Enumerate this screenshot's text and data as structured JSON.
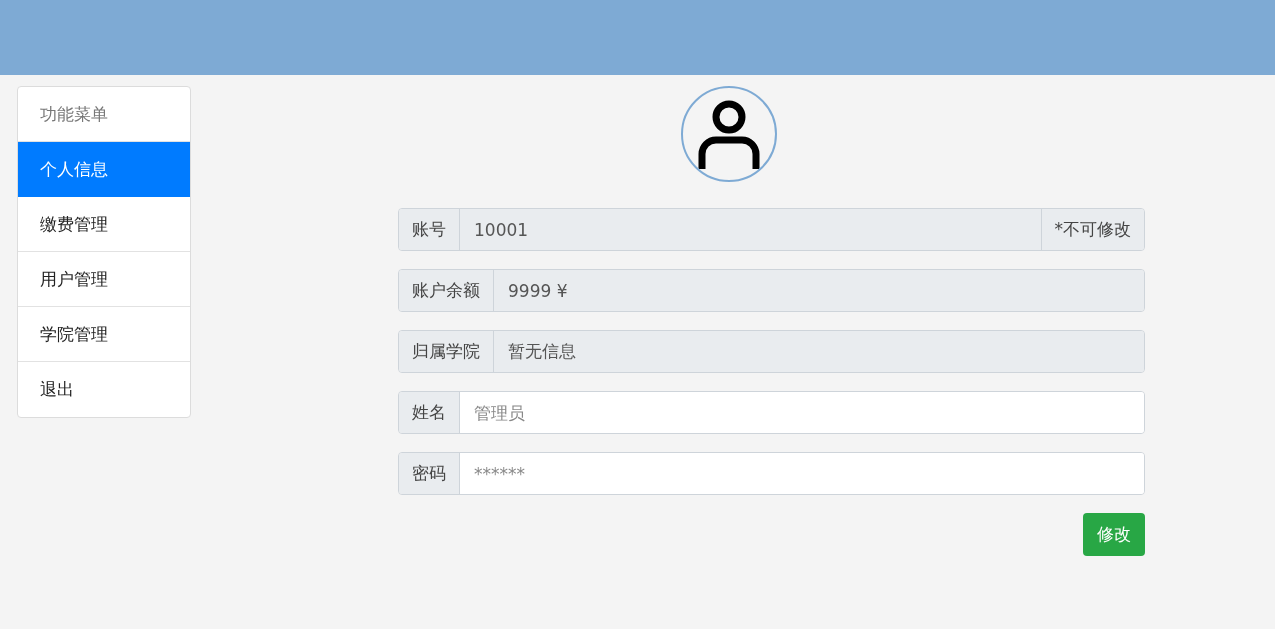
{
  "sidebar": {
    "heading": "功能菜单",
    "items": [
      {
        "label": "个人信息",
        "selected": true
      },
      {
        "label": "缴费管理",
        "selected": false
      },
      {
        "label": "用户管理",
        "selected": false
      },
      {
        "label": "学院管理",
        "selected": false
      },
      {
        "label": "退出",
        "selected": false
      }
    ]
  },
  "form": {
    "fields": [
      {
        "label": "账号",
        "value": "10001",
        "disabled": true,
        "note": "*不可修改"
      },
      {
        "label": "账户余额",
        "value": "9999 ¥",
        "disabled": true
      },
      {
        "label": "归属学院",
        "value": "暂无信息",
        "disabled": true
      },
      {
        "label": "姓名",
        "placeholder": "管理员",
        "disabled": false
      },
      {
        "label": "密码",
        "placeholder": "******",
        "disabled": false
      }
    ],
    "submit": "修改"
  }
}
